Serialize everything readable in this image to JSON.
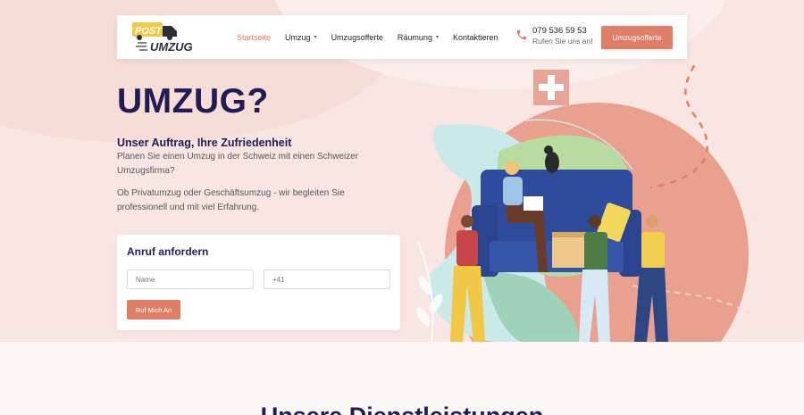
{
  "logo": {
    "word1": "POST",
    "word2": "UMZUG"
  },
  "nav": {
    "items": [
      {
        "label": "Startseite",
        "active": true,
        "dropdown": false
      },
      {
        "label": "Umzug",
        "active": false,
        "dropdown": true
      },
      {
        "label": "Umzugsofferte",
        "active": false,
        "dropdown": false
      },
      {
        "label": "Räumung",
        "active": false,
        "dropdown": true
      },
      {
        "label": "Kontaktieren",
        "active": false,
        "dropdown": false
      }
    ]
  },
  "contact": {
    "phone": "079 536 59 53",
    "subtitle": "Rufen Sie uns an!"
  },
  "header_cta": "Umzugsofferte",
  "hero": {
    "title": "UMZUG?",
    "subtitle": "Unser Auftrag, Ihre Zufriedenheit",
    "paragraph1": "Planen Sie einen Umzug in der Schweiz mit einen Schweizer Umzugsfirma?",
    "paragraph2": "Ob Privatumzug oder Geschäftsumzug - wir begleiten Sie professionell und mit viel Erfahrung."
  },
  "callback_form": {
    "title": "Anruf anfordern",
    "name_placeholder": "Name",
    "phone_placeholder": "+41",
    "submit_label": "Ruf Mich An"
  },
  "services": {
    "title": "Unsere Dienstleistungen"
  },
  "colors": {
    "accent": "#e07f67",
    "navy": "#221c55",
    "hero_bg": "#f9e6e2"
  }
}
